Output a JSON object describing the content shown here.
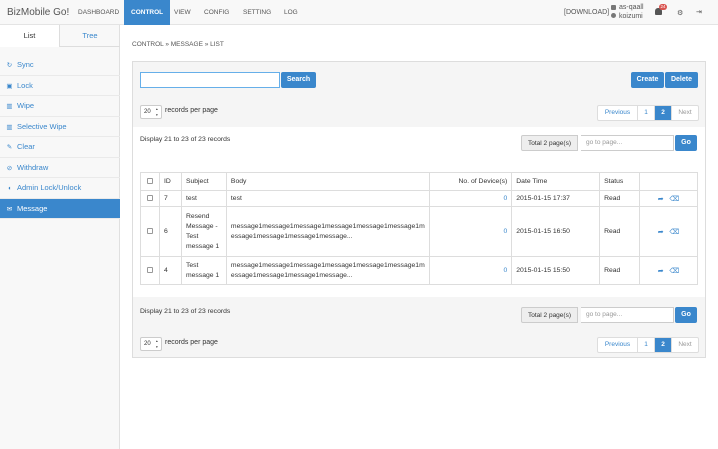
{
  "app": {
    "brand": "BizMobile Go!"
  },
  "nav": {
    "items": [
      {
        "label": "DASHBOARD",
        "active": false
      },
      {
        "label": "CONTROL",
        "active": true
      },
      {
        "label": "VIEW",
        "active": false
      },
      {
        "label": "CONFIG",
        "active": false
      },
      {
        "label": "SETTING",
        "active": false
      },
      {
        "label": "LOG",
        "active": false
      }
    ],
    "download": "[DOWNLOAD]",
    "user_id": "as-qaall",
    "user_name": "koizumi",
    "notification_count": "24"
  },
  "sidebar": {
    "tabs": [
      "List",
      "Tree"
    ],
    "items": [
      {
        "label": "Sync",
        "icon": "sync-icon",
        "glyph": "↻"
      },
      {
        "label": "Lock",
        "icon": "lock-icon",
        "glyph": "▣"
      },
      {
        "label": "Wipe",
        "icon": "trash-icon",
        "glyph": "▥"
      },
      {
        "label": "Selective Wipe",
        "icon": "trash-icon",
        "glyph": "▥"
      },
      {
        "label": "Clear",
        "icon": "eraser-icon",
        "glyph": "✎"
      },
      {
        "label": "Withdraw",
        "icon": "ban-icon",
        "glyph": "⊘"
      },
      {
        "label": "Admin Lock/Unlock",
        "icon": "shield-icon",
        "glyph": "◖"
      },
      {
        "label": "Message",
        "icon": "envelope-icon",
        "glyph": "✉",
        "active": true
      }
    ]
  },
  "breadcrumb": "CONTROL » MESSAGE » LIST",
  "toolbar": {
    "search_label": "Search",
    "search_value": "",
    "create_label": "Create",
    "delete_label": "Delete"
  },
  "paging": {
    "per_page": "20",
    "per_page_label": "records per page",
    "prev": "Previous",
    "next": "Next",
    "pages": [
      "1",
      "2"
    ],
    "current": "2",
    "display_text": "Display 21 to 23 of 23 records",
    "total_pages": "Total 2 page(s)",
    "goto_placeholder": "go to page...",
    "go_label": "Go"
  },
  "table": {
    "headers": [
      "ID",
      "Subject",
      "Body",
      "No. of Device(s)",
      "Date Time",
      "Status"
    ],
    "rows": [
      {
        "id": "7",
        "subject": "test",
        "body": "test",
        "devices": "0",
        "datetime": "2015-01-15 17:37",
        "status": "Read"
      },
      {
        "id": "6",
        "subject": "Resend Message - Test message 1",
        "body": "message1message1message1message1message1message1message1message1message1message...",
        "devices": "0",
        "datetime": "2015-01-15 16:50",
        "status": "Read"
      },
      {
        "id": "4",
        "subject": "Test message 1",
        "body": "message1message1message1message1message1message1message1message1message1message...",
        "devices": "0",
        "datetime": "2015-01-15 15:50",
        "status": "Read"
      }
    ]
  },
  "colors": {
    "accent": "#3a87cc",
    "badge": "#d9534f"
  }
}
